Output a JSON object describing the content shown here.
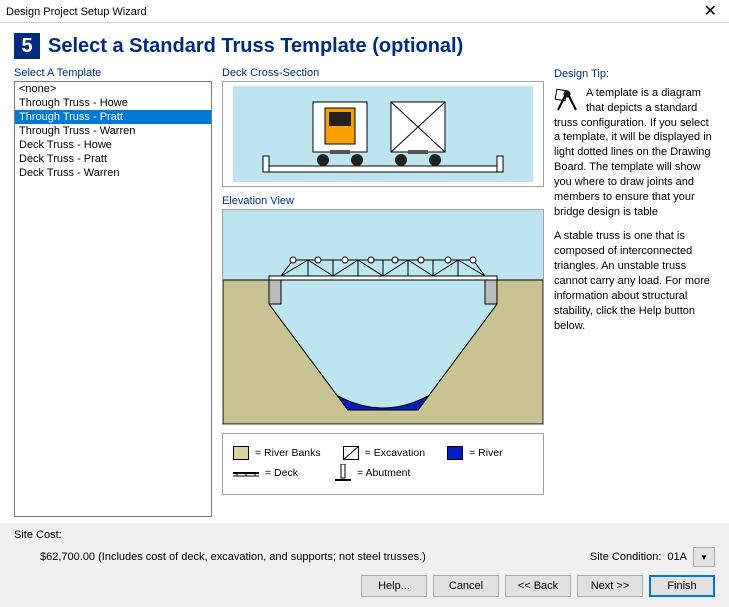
{
  "window": {
    "title": "Design Project Setup Wizard"
  },
  "step": {
    "number": "5",
    "title": "Select a Standard Truss Template (optional)"
  },
  "templates": {
    "label": "Select A Template",
    "items": [
      "<none>",
      "Through Truss - Howe",
      "Through Truss - Pratt",
      "Through Truss - Warren",
      "Deck Truss - Howe",
      "Deck Truss - Pratt",
      "Deck Truss - Warren"
    ],
    "selected_index": 2
  },
  "deck": {
    "label": "Deck Cross-Section"
  },
  "elevation": {
    "label": "Elevation View"
  },
  "legend": {
    "river_banks": "= River Banks",
    "excavation": "= Excavation",
    "river": "= River",
    "deck": "= Deck",
    "abutment": "= Abutment",
    "colors": {
      "river_banks": "#d7d49c",
      "excavation": "#ffffff",
      "river": "#0020c0"
    }
  },
  "tip": {
    "label": "Design Tip:",
    "p1": "A template is a diagram that depicts a standard truss configuration. If you select a template, it will be displayed in light dotted lines on the Drawing Board. The template will show you where to draw joints and members to ensure that your bridge design is table",
    "p2": "A stable truss is one that is composed of interconnected triangles. An unstable truss cannot carry any load. For more information about structural stability, click the Help button below."
  },
  "cost": {
    "label": "Site Cost:",
    "value": "$62,700.00  (Includes cost of deck, excavation, and supports; not steel trusses.)"
  },
  "site_condition": {
    "label": "Site Condition:",
    "value": "01A"
  },
  "buttons": {
    "help": "Help...",
    "cancel": "Cancel",
    "back": "<< Back",
    "next": "Next >>",
    "finish": "Finish"
  }
}
